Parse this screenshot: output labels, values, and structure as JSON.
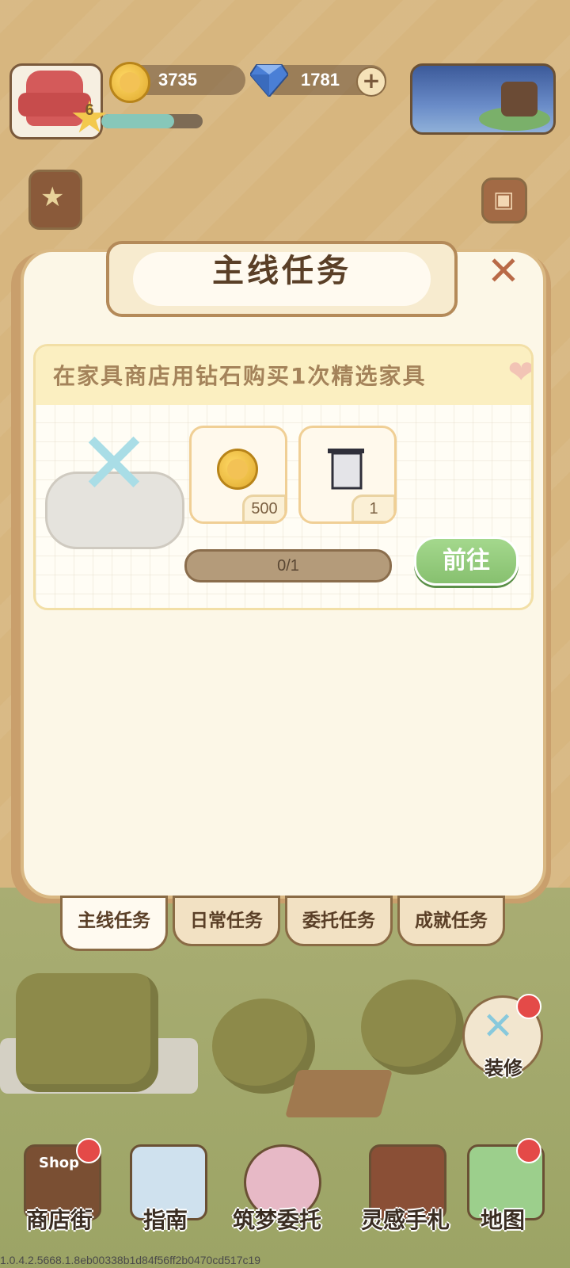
{
  "hud": {
    "level": "6",
    "xp_fraction": 0.72,
    "coins": "3735",
    "gems": "1781",
    "add_icon": "plus-icon"
  },
  "modal": {
    "title": "主线任务",
    "close_icon": "close-icon",
    "task": {
      "description": "在家具商店用钻石购买1次精选家具",
      "rewards": [
        {
          "icon": "coin-icon",
          "count": "500"
        },
        {
          "icon": "frame-icon",
          "count": "1"
        }
      ],
      "progress": "0/1",
      "go_button": "前往"
    }
  },
  "tabs": [
    {
      "label": "主线任务",
      "active": true
    },
    {
      "label": "日常任务",
      "active": false
    },
    {
      "label": "委托任务",
      "active": false
    },
    {
      "label": "成就任务",
      "active": false
    }
  ],
  "side": {
    "decorate_label": "装修"
  },
  "bottom_nav": [
    {
      "label": "商店街",
      "icon": "shop-icon",
      "badge": true
    },
    {
      "label": "指南",
      "icon": "guide-icon",
      "badge": false
    },
    {
      "label": "筑梦委托",
      "icon": "notebook-icon",
      "badge": false
    },
    {
      "label": "灵感手札",
      "icon": "quill-book-icon",
      "badge": false
    },
    {
      "label": "地图",
      "icon": "map-icon",
      "badge": true
    }
  ],
  "shop_sign": "Shop",
  "version": "1.0.4.2.5668.1.8eb00338b1d84f56ff2b0470cd517c19"
}
